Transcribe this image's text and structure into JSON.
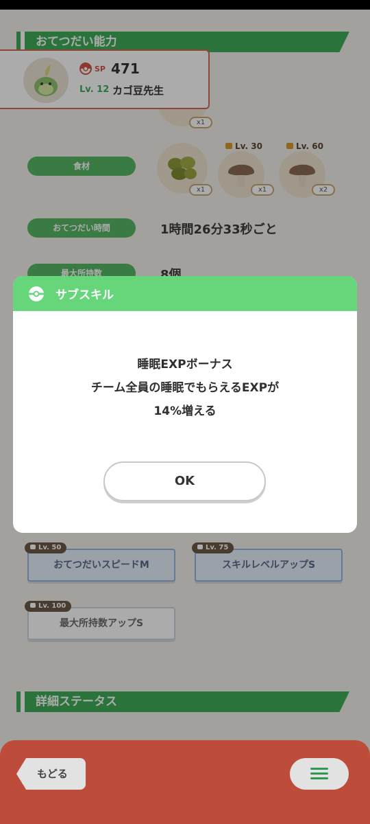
{
  "sections": {
    "helper_ability": "おてつだい能力",
    "detail_status": "詳細ステータス"
  },
  "pokemon": {
    "sp_label": "SP",
    "sp_value": "471",
    "level": "Lv. 12",
    "name": "カゴ豆先生"
  },
  "rows": {
    "ingredients_label": "食材",
    "help_time_label": "おてつだい時間",
    "help_time_value": "1時間26分33秒ごと",
    "max_carry_label": "最大所持数",
    "max_carry_value": "8個"
  },
  "ingredients": [
    {
      "name": "soybeans",
      "count": "x1",
      "lv": ""
    },
    {
      "name": "mushroom",
      "count": "x1",
      "lv": "Lv. 30"
    },
    {
      "name": "mushroom",
      "count": "x2",
      "lv": "Lv. 60"
    }
  ],
  "top_item_count": "x1",
  "subskills": [
    {
      "lv": "Lv. 50",
      "label": "おてつだいスピードM"
    },
    {
      "lv": "Lv. 75",
      "label": "スキルレベルアップS"
    },
    {
      "lv": "Lv. 100",
      "label": "最大所持数アップS"
    }
  ],
  "modal": {
    "title": "サブスキル",
    "line1": "睡眠EXPボーナス",
    "line2": "チーム全員の睡眠でもらえるEXPが",
    "line3": "14%増える",
    "ok": "OK"
  },
  "bottom": {
    "back": "もどる"
  },
  "colors": {
    "accent_green": "#3fae5a",
    "modal_header": "#67d67b",
    "bottom_bar": "#bd4d3a"
  }
}
